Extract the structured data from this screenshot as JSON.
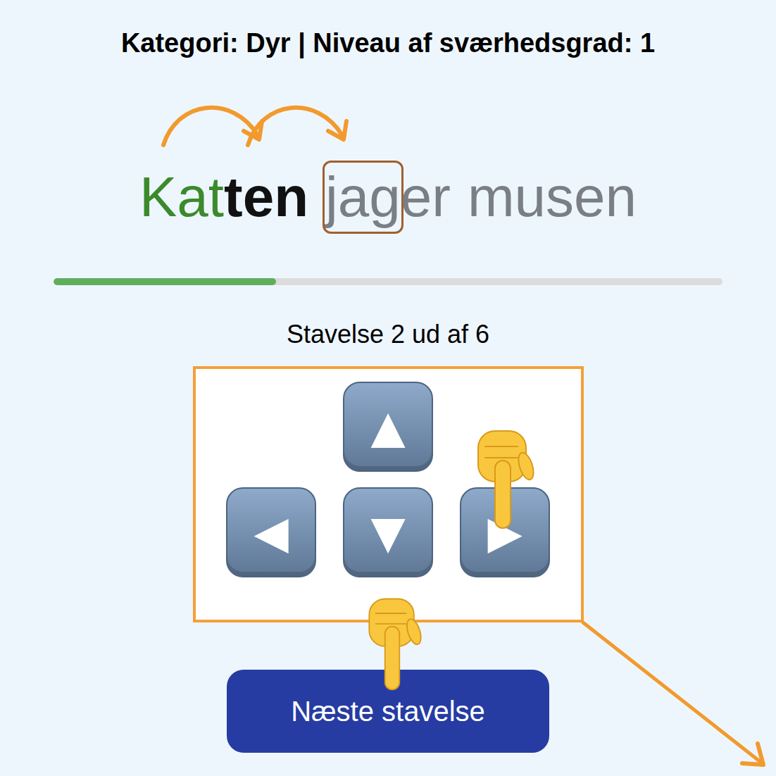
{
  "header": {
    "title": "Kategori: Dyr | Niveau af sværhedsgrad: 1"
  },
  "sentence": {
    "words": [
      {
        "syllables": [
          {
            "text": "Kat",
            "kind": "done",
            "boxed": false
          },
          {
            "text": "ten",
            "kind": "current",
            "boxed": false
          }
        ]
      },
      {
        "syllables": [
          {
            "text": "jag",
            "kind": "pending",
            "boxed": true
          },
          {
            "text": "er",
            "kind": "pending",
            "boxed": false
          }
        ]
      },
      {
        "syllables": [
          {
            "text": "mu",
            "kind": "pending",
            "boxed": false
          },
          {
            "text": "sen",
            "kind": "pending",
            "boxed": false
          }
        ]
      }
    ]
  },
  "progress": {
    "level": 0.333
  },
  "counter": "Stavelse 2 ud af 6",
  "keys": [
    {
      "glyph": "▲",
      "pointed": false
    },
    {
      "glyph": "◀",
      "pointed": false
    },
    {
      "glyph": "▼",
      "pointed": false
    },
    {
      "glyph": "▶",
      "pointed": true
    }
  ],
  "next_button": {
    "label": "Næste stavelse",
    "pointed": true
  }
}
